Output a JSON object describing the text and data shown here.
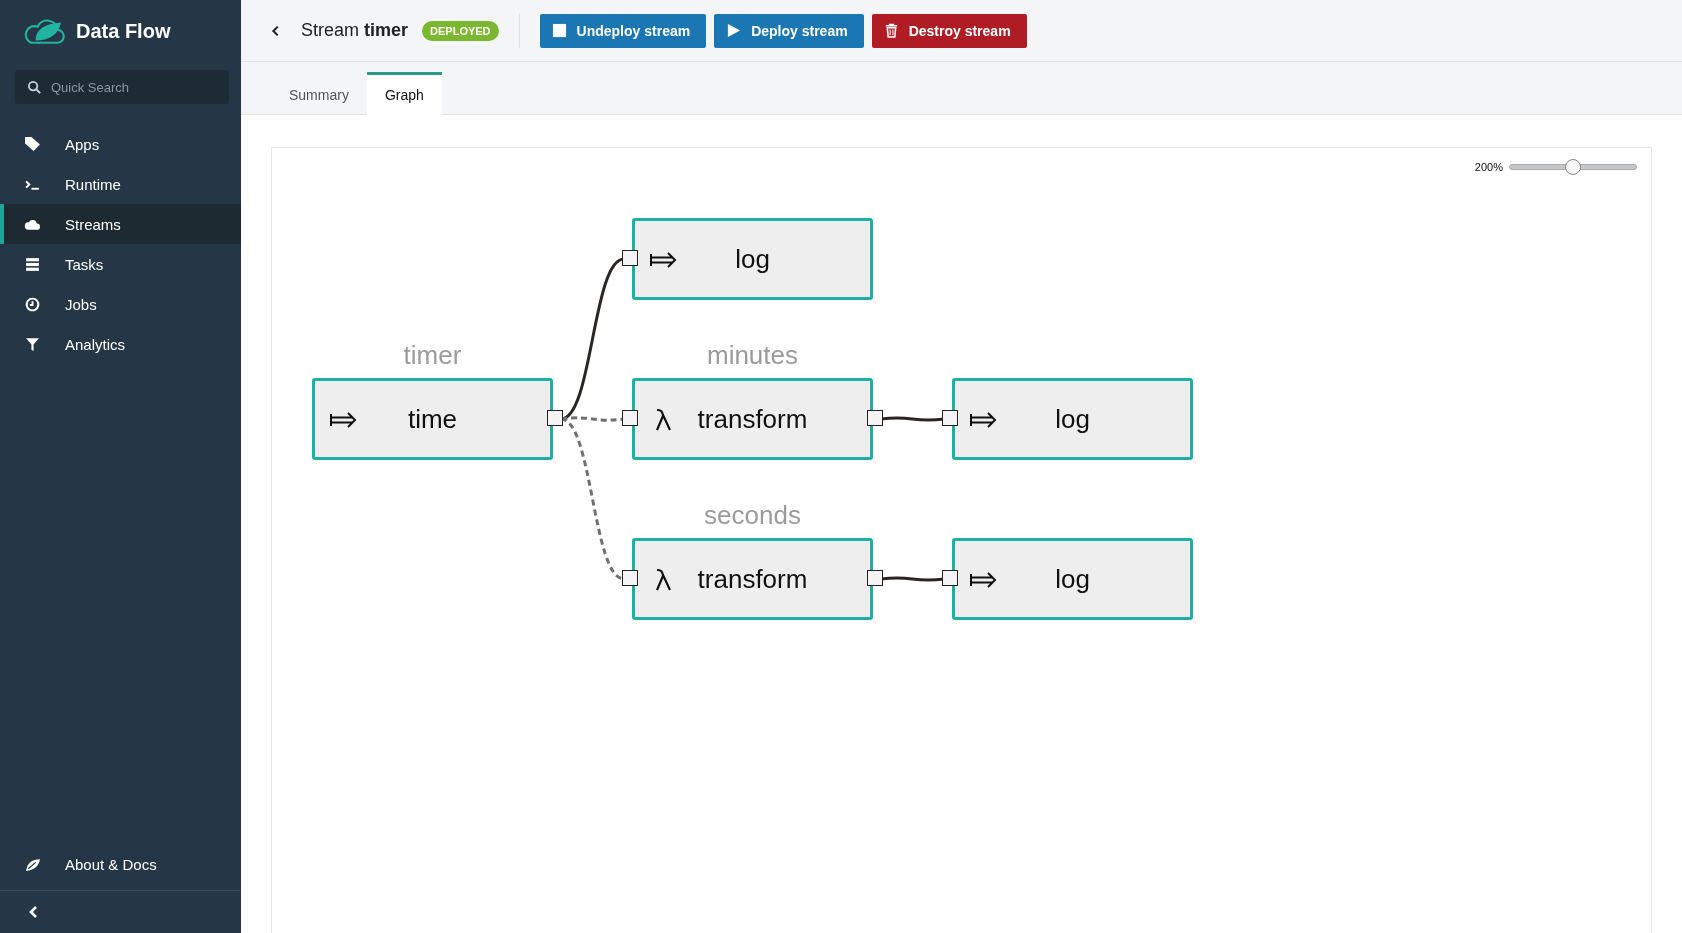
{
  "sidebar": {
    "app_name": "Data Flow",
    "search": {
      "placeholder": "Quick Search"
    },
    "items": [
      {
        "label": "Apps",
        "selected": false
      },
      {
        "label": "Runtime",
        "selected": false
      },
      {
        "label": "Streams",
        "selected": true
      },
      {
        "label": "Tasks",
        "selected": false
      },
      {
        "label": "Jobs",
        "selected": false
      },
      {
        "label": "Analytics",
        "selected": false
      }
    ],
    "footer_item": {
      "label": "About & Docs"
    }
  },
  "header": {
    "title": "Stream **timer**",
    "status": "DEPLOYED",
    "buttons": [
      {
        "label": "Undeploy stream",
        "kind": "undeploy"
      },
      {
        "label": "Deploy stream",
        "kind": "deploy"
      },
      {
        "label": "Destroy stream",
        "kind": "destroy"
      }
    ]
  },
  "tabs": [
    {
      "label": "Summary",
      "selected": false
    },
    {
      "label": "Graph",
      "selected": true
    }
  ],
  "zoom": {
    "reading": "200%",
    "level": 0.5
  },
  "graph": {
    "source": {
      "group": "timer",
      "name": "time",
      "kind": "source"
    },
    "branches": [
      {
        "dashed": false,
        "nodes": [
          {
            "name": "log",
            "kind": "sink"
          }
        ]
      },
      {
        "group": "minutes",
        "dashed": true,
        "nodes": [
          {
            "name": "transform",
            "kind": "processor"
          },
          {
            "name": "log",
            "kind": "sink"
          }
        ]
      },
      {
        "group": "seconds",
        "dashed": true,
        "nodes": [
          {
            "name": "transform",
            "kind": "processor"
          },
          {
            "name": "log",
            "kind": "sink"
          }
        ]
      }
    ]
  }
}
